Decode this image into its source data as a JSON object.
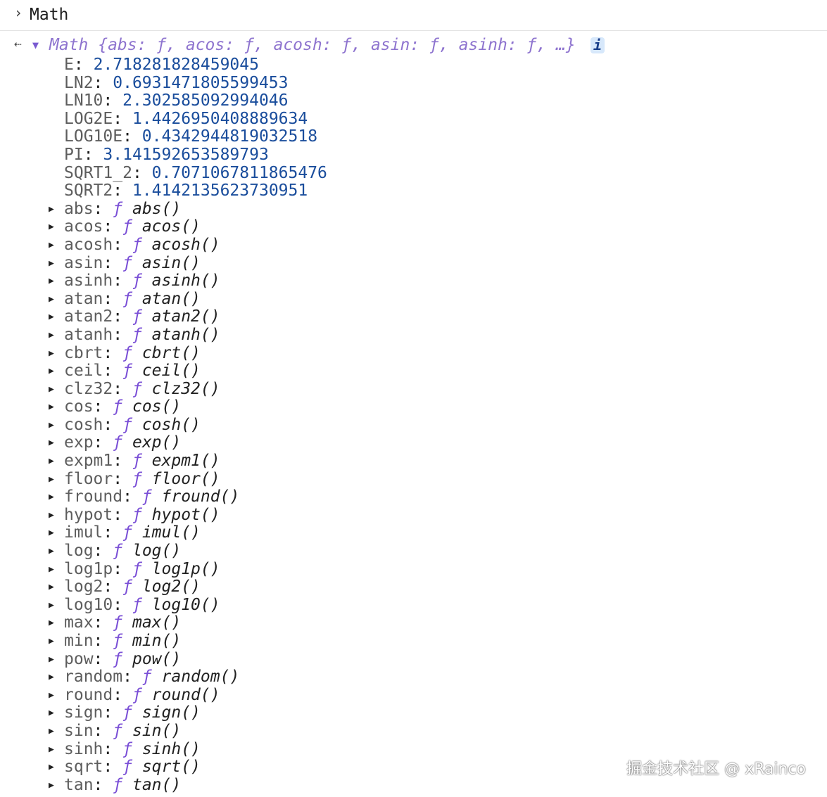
{
  "input": {
    "prompt_icon": "chevron-right-icon",
    "text": "Math"
  },
  "result": {
    "return_icon": "return-arrow-icon",
    "summary": "Math {abs: ƒ, acos: ƒ, acosh: ƒ, asin: ƒ, asinh: ƒ, …}",
    "info": "i"
  },
  "constants": [
    {
      "key": "E",
      "value": "2.718281828459045"
    },
    {
      "key": "LN2",
      "value": "0.6931471805599453"
    },
    {
      "key": "LN10",
      "value": "2.302585092994046"
    },
    {
      "key": "LOG2E",
      "value": "1.4426950408889634"
    },
    {
      "key": "LOG10E",
      "value": "0.4342944819032518"
    },
    {
      "key": "PI",
      "value": "3.141592653589793"
    },
    {
      "key": "SQRT1_2",
      "value": "0.7071067811865476"
    },
    {
      "key": "SQRT2",
      "value": "1.4142135623730951"
    }
  ],
  "functions": [
    {
      "key": "abs",
      "value": "abs()"
    },
    {
      "key": "acos",
      "value": "acos()"
    },
    {
      "key": "acosh",
      "value": "acosh()"
    },
    {
      "key": "asin",
      "value": "asin()"
    },
    {
      "key": "asinh",
      "value": "asinh()"
    },
    {
      "key": "atan",
      "value": "atan()"
    },
    {
      "key": "atan2",
      "value": "atan2()"
    },
    {
      "key": "atanh",
      "value": "atanh()"
    },
    {
      "key": "cbrt",
      "value": "cbrt()"
    },
    {
      "key": "ceil",
      "value": "ceil()"
    },
    {
      "key": "clz32",
      "value": "clz32()"
    },
    {
      "key": "cos",
      "value": "cos()"
    },
    {
      "key": "cosh",
      "value": "cosh()"
    },
    {
      "key": "exp",
      "value": "exp()"
    },
    {
      "key": "expm1",
      "value": "expm1()"
    },
    {
      "key": "floor",
      "value": "floor()"
    },
    {
      "key": "fround",
      "value": "fround()"
    },
    {
      "key": "hypot",
      "value": "hypot()"
    },
    {
      "key": "imul",
      "value": "imul()"
    },
    {
      "key": "log",
      "value": "log()"
    },
    {
      "key": "log1p",
      "value": "log1p()"
    },
    {
      "key": "log2",
      "value": "log2()"
    },
    {
      "key": "log10",
      "value": "log10()"
    },
    {
      "key": "max",
      "value": "max()"
    },
    {
      "key": "min",
      "value": "min()"
    },
    {
      "key": "pow",
      "value": "pow()"
    },
    {
      "key": "random",
      "value": "random()"
    },
    {
      "key": "round",
      "value": "round()"
    },
    {
      "key": "sign",
      "value": "sign()"
    },
    {
      "key": "sin",
      "value": "sin()"
    },
    {
      "key": "sinh",
      "value": "sinh()"
    },
    {
      "key": "sqrt",
      "value": "sqrt()"
    },
    {
      "key": "tan",
      "value": "tan()"
    }
  ],
  "function_glyph": "ƒ",
  "watermark": "掘金技术社区 @ xRainco"
}
